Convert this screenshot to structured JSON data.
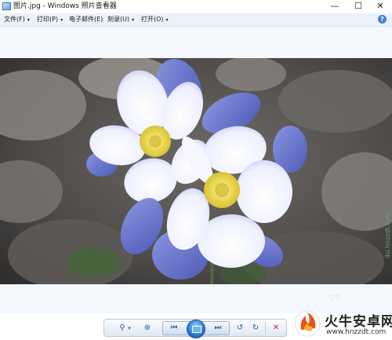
{
  "window": {
    "title": "图片.jpg - Windows 照片查看器",
    "controls": {
      "minimize": "—",
      "maximize": "☐",
      "close": "✕"
    }
  },
  "menu": {
    "items": [
      {
        "label": "文件(F)",
        "caret": "▾"
      },
      {
        "label": "打印(P)",
        "caret": "▾"
      },
      {
        "label": "电子邮件(E)"
      },
      {
        "label": "刻录(U)",
        "caret": "▾"
      },
      {
        "label": "打开(O)",
        "caret": "▾"
      }
    ],
    "help_glyph": "?"
  },
  "photo": {
    "subject": "blue and white columbine flowers",
    "side_text": "4u.hnzzdt.com"
  },
  "toolbar": {
    "zoom_glyph": "⚲",
    "zoom_caret": "▾",
    "fit_glyph": "⊕",
    "prev_glyph": "⏮",
    "next_glyph": "⏭",
    "rotate_ccw_glyph": "↺",
    "rotate_cw_glyph": "↻",
    "delete_glyph": "✕"
  },
  "watermark": {
    "name": "火牛安卓网",
    "url": "www.hnzzdt.com",
    "hearts": "♡♡"
  },
  "colors": {
    "menubar_bg": "#eaf2fb",
    "viewer_bg": "#f4f8fc",
    "petal_blue": "#6f7fd0",
    "petal_white": "#f3f5ff",
    "stamen_yellow": "#e8d84a"
  }
}
